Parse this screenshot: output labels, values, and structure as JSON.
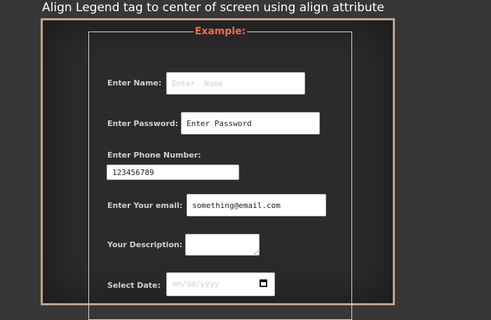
{
  "page": {
    "title": "Align Legend tag to center of screen using align attribute"
  },
  "form": {
    "legend": "Example:",
    "fields": {
      "name": {
        "label": "Enter Name:",
        "placeholder": "Enter  Name",
        "value": ""
      },
      "password": {
        "label": "Enter Password:",
        "placeholder": "Enter Password",
        "value": ""
      },
      "phone": {
        "label": "Enter Phone Number:",
        "placeholder": "",
        "value": "123456789"
      },
      "email": {
        "label": "Enter Your email:",
        "placeholder": "",
        "value": "something@email.com"
      },
      "description": {
        "label": "Your Description:",
        "placeholder": "",
        "value": ""
      },
      "date": {
        "label": "Select Date:",
        "placeholder": "mm/dd/yyyy"
      }
    }
  },
  "colors": {
    "background": "#373737",
    "panel_border": "#c4a48a",
    "legend": "#ff6a4d",
    "label": "#d0d0d0"
  }
}
